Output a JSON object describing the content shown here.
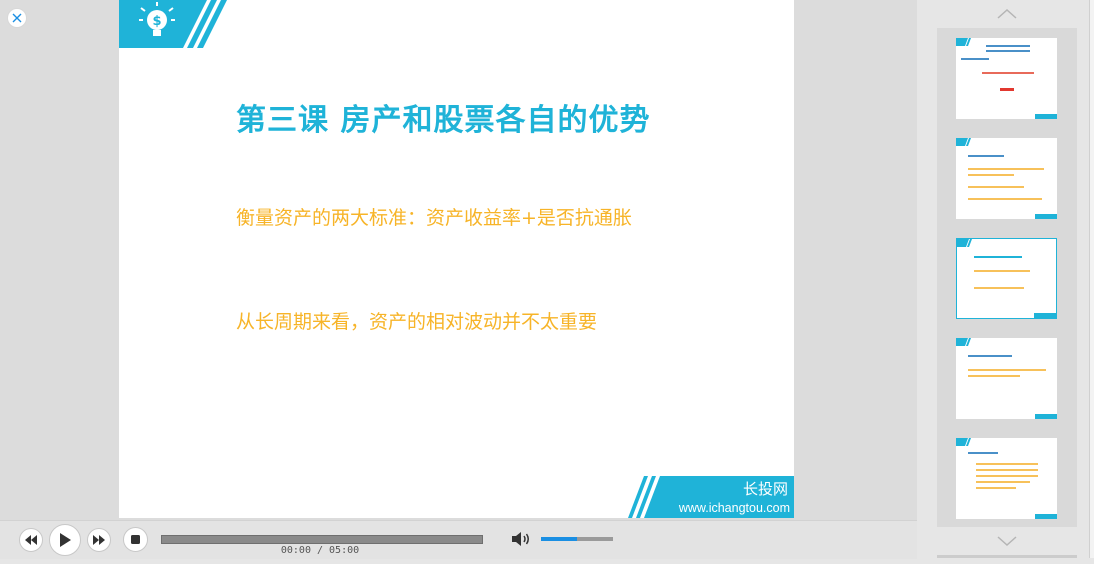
{
  "slide": {
    "title": "第三课 房产和股票各自的优势",
    "line1": "衡量资产的两大标准：资产收益率+是否抗通胀",
    "line2": "从长周期来看，资产的相对波动并不太重要",
    "brand_name": "长投网",
    "brand_url": "www.ichangtou.com"
  },
  "player": {
    "time": "00:00 / 05:00",
    "progress_fraction": 0,
    "volume_fraction": 0.5
  },
  "thumbnails": [
    {
      "index": 1,
      "active": false
    },
    {
      "index": 2,
      "active": false
    },
    {
      "index": 3,
      "active": true
    },
    {
      "index": 4,
      "active": false
    },
    {
      "index": 5,
      "active": false
    }
  ],
  "colors": {
    "accent": "#1fb3d8",
    "text_orange": "#f7b428",
    "volume": "#1a8fe3"
  },
  "icons": [
    "close-icon",
    "lightbulb-dollar-icon",
    "rewind-icon",
    "play-icon",
    "fast-forward-icon",
    "stop-icon",
    "volume-icon",
    "chevron-up-icon",
    "chevron-down-icon"
  ]
}
